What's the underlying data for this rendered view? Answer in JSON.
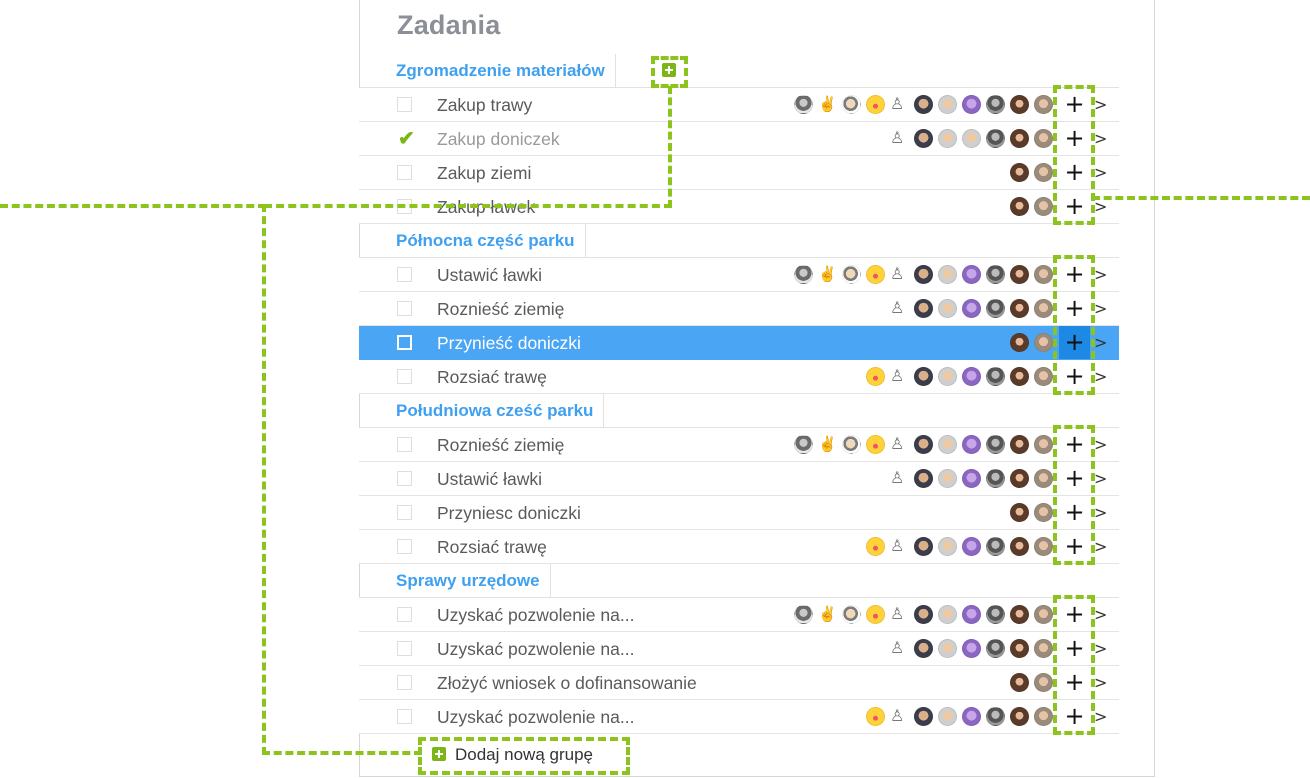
{
  "title": "Zadania",
  "groups": [
    {
      "name": "Zgromadzenie materiałów",
      "tasks": [
        {
          "label": "Zakup trawy",
          "done": false,
          "avatars": [
            "a",
            "b",
            "c",
            "d",
            "e",
            "f",
            "g",
            "h",
            "i",
            "j",
            "k"
          ]
        },
        {
          "label": "Zakup doniczek",
          "done": true,
          "avatars": [
            "e",
            "f",
            "g",
            "g",
            "i",
            "j",
            "k"
          ]
        },
        {
          "label": "Zakup ziemi",
          "done": false,
          "avatars": [
            "j",
            "k"
          ]
        },
        {
          "label": "Zakup ławek",
          "done": false,
          "avatars": [
            "j",
            "k"
          ]
        }
      ]
    },
    {
      "name": "Północna część parku",
      "tasks": [
        {
          "label": "Ustawić ławki",
          "done": false,
          "avatars": [
            "a",
            "b",
            "c",
            "d",
            "e",
            "f",
            "g",
            "h",
            "i",
            "j",
            "k"
          ]
        },
        {
          "label": "Roznieść ziemię",
          "done": false,
          "avatars": [
            "e",
            "f",
            "g",
            "h",
            "i",
            "j",
            "k"
          ]
        },
        {
          "label": "Przynieść doniczki",
          "done": false,
          "selected": true,
          "avatars": [
            "j",
            "k"
          ]
        },
        {
          "label": "Rozsiać trawę",
          "done": false,
          "avatars": [
            "d",
            "e",
            "f",
            "g",
            "h",
            "i",
            "j",
            "k"
          ]
        }
      ]
    },
    {
      "name": "Południowa cześć parku",
      "tasks": [
        {
          "label": "Roznieść ziemię",
          "done": false,
          "avatars": [
            "a",
            "b",
            "c",
            "d",
            "e",
            "f",
            "g",
            "h",
            "i",
            "j",
            "k"
          ]
        },
        {
          "label": "Ustawić ławki",
          "done": false,
          "avatars": [
            "e",
            "f",
            "g",
            "h",
            "i",
            "j",
            "k"
          ]
        },
        {
          "label": "Przyniesc doniczki",
          "done": false,
          "avatars": [
            "j",
            "k"
          ]
        },
        {
          "label": "Rozsiać trawę",
          "done": false,
          "avatars": [
            "d",
            "e",
            "f",
            "g",
            "h",
            "i",
            "j",
            "k"
          ]
        }
      ]
    },
    {
      "name": "Sprawy urzędowe",
      "tasks": [
        {
          "label": "Uzyskać pozwolenie na...",
          "done": false,
          "avatars": [
            "a",
            "b",
            "c",
            "d",
            "e",
            "f",
            "g",
            "h",
            "i",
            "j",
            "k"
          ]
        },
        {
          "label": "Uzyskać pozwolenie na...",
          "done": false,
          "avatars": [
            "e",
            "f",
            "g",
            "h",
            "i",
            "j",
            "k"
          ]
        },
        {
          "label": "Złożyć wniosek o dofinansowanie",
          "done": false,
          "avatars": [
            "j",
            "k"
          ]
        },
        {
          "label": "Uzyskać pozwolenie na...",
          "done": false,
          "avatars": [
            "d",
            "e",
            "f",
            "g",
            "h",
            "i",
            "j",
            "k"
          ]
        }
      ]
    }
  ],
  "add_task_symbol": "+",
  "expand_symbol": ">",
  "add_group_label": "Dodaj nową grupę",
  "colors": {
    "accent": "#3fa0f0",
    "selected_row": "#4aa5f5",
    "highlight": "#8cc31c",
    "add_icon": "#7bb518"
  }
}
